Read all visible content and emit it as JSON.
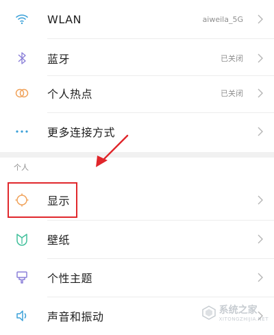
{
  "connections": [
    {
      "label": "WLAN",
      "status": "aiweila_5G",
      "icon": "wifi-icon",
      "icon_color": "#3aa0d8"
    },
    {
      "label": "蓝牙",
      "status": "已关闭",
      "icon": "bluetooth-icon",
      "icon_color": "#8a7fd8"
    },
    {
      "label": "个人热点",
      "status": "已关闭",
      "icon": "hotspot-icon",
      "icon_color": "#f0a25a"
    },
    {
      "label": "更多连接方式",
      "status": "",
      "icon": "more-dots-icon",
      "icon_color": "#3aa0d8"
    }
  ],
  "personal": {
    "section_label": "个人",
    "items": [
      {
        "label": "显示",
        "icon": "display-icon",
        "icon_color": "#f0a25a"
      },
      {
        "label": "壁纸",
        "icon": "wallpaper-icon",
        "icon_color": "#3fbf9a"
      },
      {
        "label": "个性主题",
        "icon": "theme-icon",
        "icon_color": "#8a7fd8"
      },
      {
        "label": "声音和振动",
        "icon": "sound-icon",
        "icon_color": "#3aa0d8"
      }
    ]
  },
  "annotation": {
    "highlight_color": "#e0262b",
    "arrow_color": "#e0262b"
  },
  "watermark": {
    "text": "系统之家",
    "sub": "XITONGZHIJIA.NET"
  }
}
